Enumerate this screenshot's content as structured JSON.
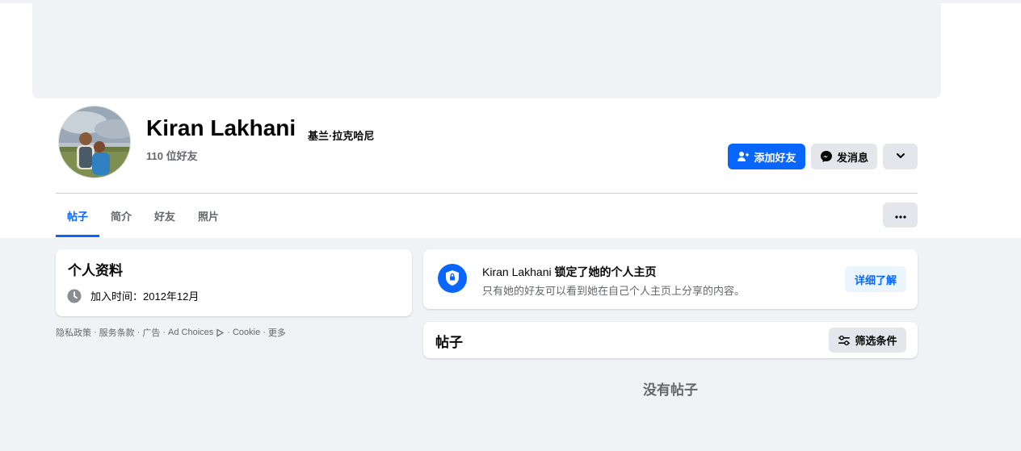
{
  "profile": {
    "name": "Kiran Lakhani",
    "alt_name": "基兰·拉克哈尼",
    "friends_count": "110 位好友"
  },
  "actions": {
    "add_friend": "添加好友",
    "message": "发消息"
  },
  "tabs": [
    {
      "label": "帖子",
      "active": true
    },
    {
      "label": "简介",
      "active": false
    },
    {
      "label": "好友",
      "active": false
    },
    {
      "label": "照片",
      "active": false
    }
  ],
  "intro": {
    "title": "个人资料",
    "joined": "加入时间：2012年12月"
  },
  "footer": {
    "links": [
      "隐私政策",
      "服务条款",
      "广告",
      "Ad Choices",
      "Cookie",
      "更多"
    ]
  },
  "lock_notice": {
    "name": "Kiran Lakhani",
    "title_rest": " 锁定了她的个人主页",
    "description": "只有她的好友可以看到她在自己个人主页上分享的内容。",
    "learn_more": "详细了解"
  },
  "posts": {
    "title": "帖子",
    "filter": "筛选条件",
    "empty": "没有帖子"
  },
  "colors": {
    "accent": "#0866ff",
    "background": "#f0f2f5",
    "secondary_button": "#e4e6eb",
    "muted_text": "#65676b"
  },
  "icons": [
    "add-friend-icon",
    "messenger-icon",
    "chevron-down-icon",
    "more-icon",
    "clock-icon",
    "shield-lock-icon",
    "filter-icon",
    "ad-choices-icon"
  ]
}
